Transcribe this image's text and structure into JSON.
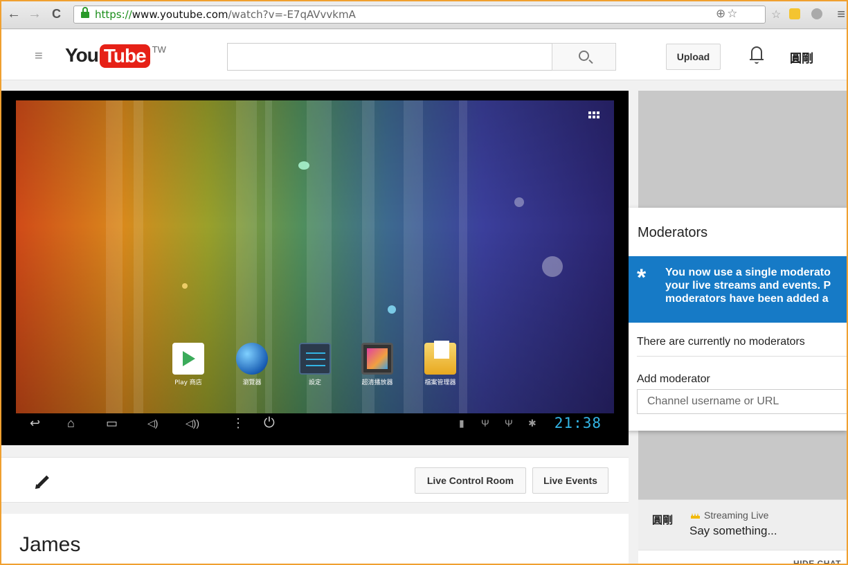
{
  "browser": {
    "url_scheme": "https://",
    "url_host": "www.youtube.com",
    "url_path": "/watch?v=-E7qAVvvkmA",
    "icons": [
      "back-arrow-icon",
      "forward-arrow-icon",
      "reload-icon",
      "lock-icon",
      "zoom-icon",
      "bookmark-star-icon",
      "extension-icon",
      "menu-icon"
    ]
  },
  "header": {
    "logo_you": "You",
    "logo_tube": "Tube",
    "logo_region": "TW",
    "search_placeholder": "",
    "upload_label": "Upload",
    "account_name": "圓剛"
  },
  "player": {
    "apps": [
      {
        "label": "Play 商店",
        "icon": "play-store-icon"
      },
      {
        "label": "瀏覽器",
        "icon": "browser-globe-icon"
      },
      {
        "label": "設定",
        "icon": "settings-icon"
      },
      {
        "label": "超清播放器",
        "icon": "media-player-icon"
      },
      {
        "label": "檔案管理器",
        "icon": "file-manager-icon"
      }
    ],
    "clock": "21:38"
  },
  "actions": {
    "live_control_room": "Live Control Room",
    "live_events": "Live Events"
  },
  "video": {
    "title": "James"
  },
  "moderators": {
    "title": "Moderators",
    "banner_lines": [
      "You now use a single moderato",
      "your live streams and events. P",
      "moderators have been added a"
    ],
    "empty_text": "There are currently no moderators",
    "add_label": "Add moderator",
    "input_placeholder": "Channel username or URL"
  },
  "chat": {
    "avatar_text": "圓剛",
    "status": "Streaming Live",
    "input_placeholder": "Say something...",
    "hide_label": "HIDE CHAT"
  },
  "colors": {
    "youtube_red": "#e62117",
    "banner_blue": "#167ac6",
    "clock_blue": "#33b5e5",
    "window_border": "#f0a030"
  }
}
